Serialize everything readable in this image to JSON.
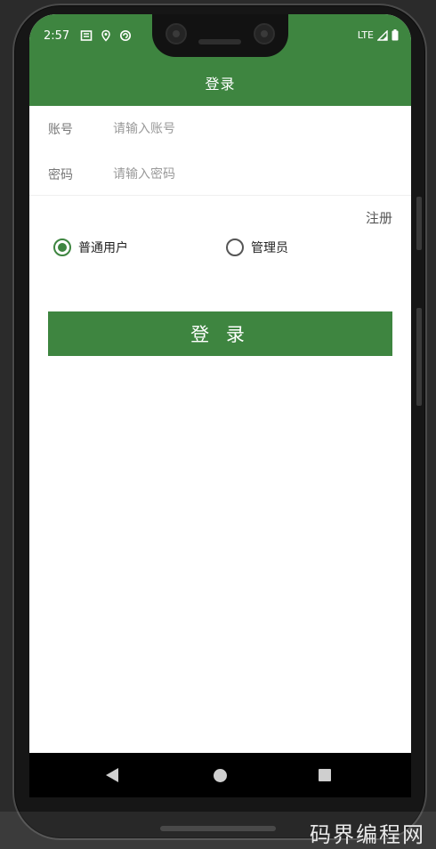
{
  "status_bar": {
    "time": "2:57",
    "network": "LTE",
    "left_icons": [
      "news-icon",
      "location-icon",
      "sync-icon"
    ],
    "right_icons": [
      "signal-icon",
      "battery-icon"
    ]
  },
  "app_bar": {
    "title": "登录"
  },
  "form": {
    "account": {
      "label": "账号",
      "value": "",
      "placeholder": "请输入账号"
    },
    "password": {
      "label": "密码",
      "value": "",
      "placeholder": "请输入密码"
    }
  },
  "register_link": "注册",
  "role_selection": {
    "options": [
      {
        "label": "普通用户",
        "checked": true
      },
      {
        "label": "管理员",
        "checked": false
      }
    ]
  },
  "login_button": "登 录",
  "nav_bar": {
    "icons": [
      "back-icon",
      "home-icon",
      "recents-icon"
    ]
  },
  "watermark": "码界编程网",
  "colors": {
    "primary": "#3e8540",
    "background": "#ffffff",
    "nav_bar": "#000000"
  }
}
